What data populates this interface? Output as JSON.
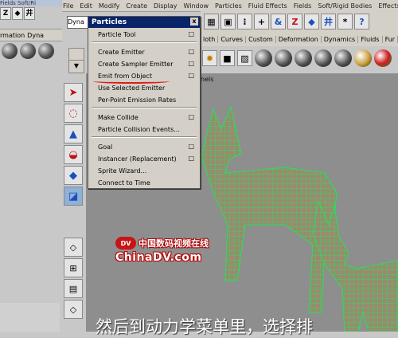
{
  "menubar": {
    "items": [
      "File",
      "Edit",
      "Modify",
      "Create",
      "Display",
      "Window",
      "Particles",
      "Fluid Effects",
      "Fields",
      "Soft/Rigid Bodies",
      "Effects"
    ]
  },
  "left_window": {
    "top_fragment": "Fields  Soft/Ri",
    "shelf_tabs": [
      "rmation",
      "Dyna"
    ]
  },
  "dyna_field": "Dyna",
  "particles_menu": {
    "title": "Particles",
    "close_glyph": "x",
    "items": [
      {
        "label": "Particle Tool",
        "option_box": true
      },
      {
        "label": "Create Emitter",
        "option_box": true
      },
      {
        "label": "Create Sampler Emitter",
        "option_box": true
      },
      {
        "label": "Emit from Object",
        "option_box": true
      },
      {
        "label": "Use Selected Emitter",
        "option_box": false
      },
      {
        "label": "Per-Point Emission Rates",
        "option_box": false
      },
      {
        "label": "Make Collide",
        "option_box": true
      },
      {
        "label": "Particle Collision Events...",
        "option_box": false
      },
      {
        "label": "Goal",
        "option_box": true
      },
      {
        "label": "Instancer (Replacement)",
        "option_box": true
      },
      {
        "label": "Sprite Wizard...",
        "option_box": false
      },
      {
        "label": "Connect to Time",
        "option_box": false
      }
    ],
    "highlighted_item": "Emit from Object",
    "highlight_color": "#e01818"
  },
  "shelf_tabs": [
    "loth",
    "Curves",
    "Custom",
    "Deformation",
    "Dynamics",
    "Fluids",
    "Fur"
  ],
  "status_icons": [
    "+",
    "&",
    "Z",
    "◆",
    "井",
    "*",
    "?"
  ],
  "viewport": {
    "panels_label": "nels",
    "background": "#8e8e8e",
    "mesh_color": "#27e05a"
  },
  "watermark": {
    "logo": "DV",
    "cn_text": "中国数码视频在线",
    "en_text": "ChinaDV.com"
  },
  "subtitle": "然后到动力学菜单里，选择排"
}
